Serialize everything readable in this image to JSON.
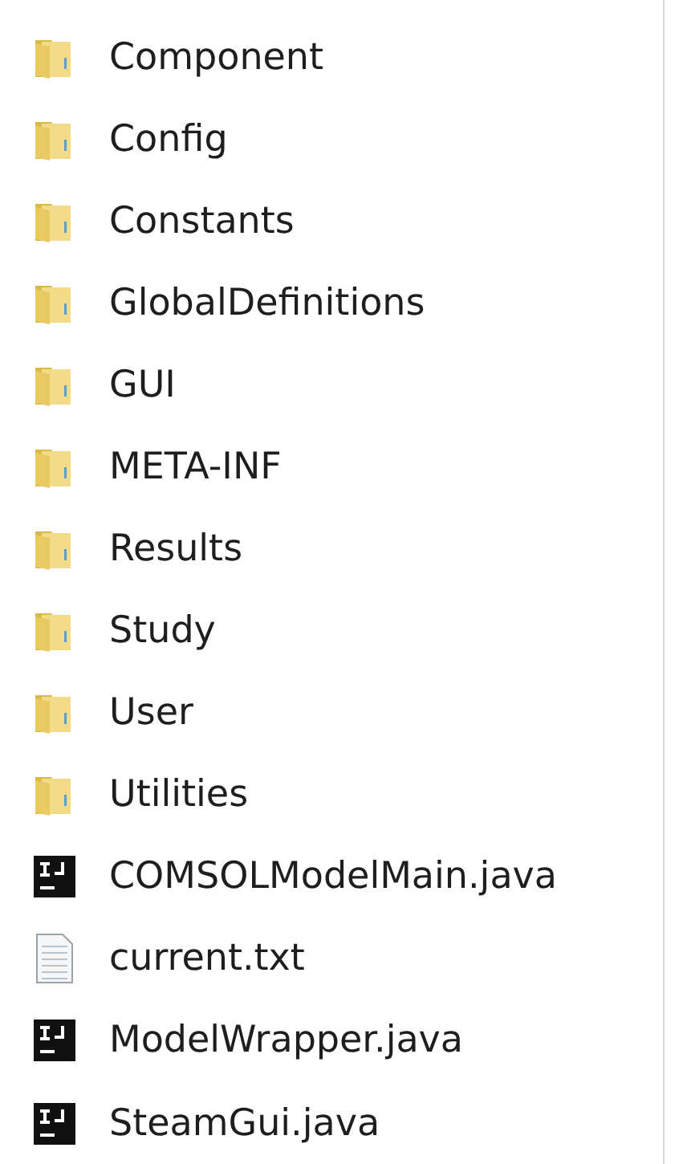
{
  "files": [
    {
      "name": "Component",
      "kind": "folder"
    },
    {
      "name": "Config",
      "kind": "folder"
    },
    {
      "name": "Constants",
      "kind": "folder"
    },
    {
      "name": "GlobalDefinitions",
      "kind": "folder"
    },
    {
      "name": "GUI",
      "kind": "folder"
    },
    {
      "name": "META-INF",
      "kind": "folder"
    },
    {
      "name": "Results",
      "kind": "folder"
    },
    {
      "name": "Study",
      "kind": "folder"
    },
    {
      "name": "User",
      "kind": "folder"
    },
    {
      "name": "Utilities",
      "kind": "folder"
    },
    {
      "name": "COMSOLModelMain.java",
      "kind": "java"
    },
    {
      "name": "current.txt",
      "kind": "text"
    },
    {
      "name": "ModelWrapper.java",
      "kind": "java"
    },
    {
      "name": "SteamGui.java",
      "kind": "java"
    }
  ]
}
